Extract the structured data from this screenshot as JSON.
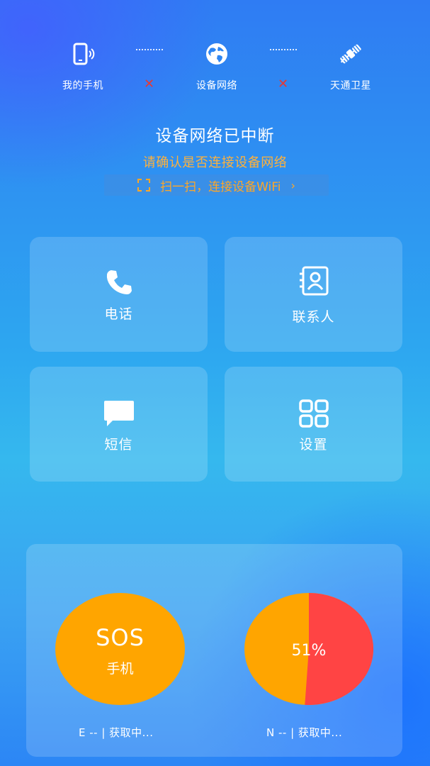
{
  "connection": {
    "nodes": [
      {
        "label": "我的手机",
        "icon": "phone-signal-icon"
      },
      {
        "label": "设备网络",
        "icon": "globe-icon"
      },
      {
        "label": "天通卫星",
        "icon": "satellite-icon"
      }
    ],
    "status_mark": "✕",
    "status_color": "#e53935"
  },
  "alert": {
    "title": "设备网络已中断",
    "subtitle": "请确认是否连接设备网络",
    "scan_label": "扫一扫，连接设备WiFi",
    "scan_chevron": "›",
    "accent": "#ffa726"
  },
  "tiles": [
    {
      "label": "电话",
      "icon": "phone-icon"
    },
    {
      "label": "联系人",
      "icon": "contacts-icon"
    },
    {
      "label": "短信",
      "icon": "message-icon"
    },
    {
      "label": "设置",
      "icon": "grid-icon"
    }
  ],
  "sos": {
    "title": "SOS",
    "subtitle": "手机",
    "color": "#ffa500"
  },
  "battery": {
    "percent_label": "51%",
    "percent": 51,
    "fill_color": "#ff4444",
    "base_color": "#ffa500"
  },
  "coords": {
    "east": "E -- | 获取中...",
    "north": "N -- | 获取中..."
  }
}
